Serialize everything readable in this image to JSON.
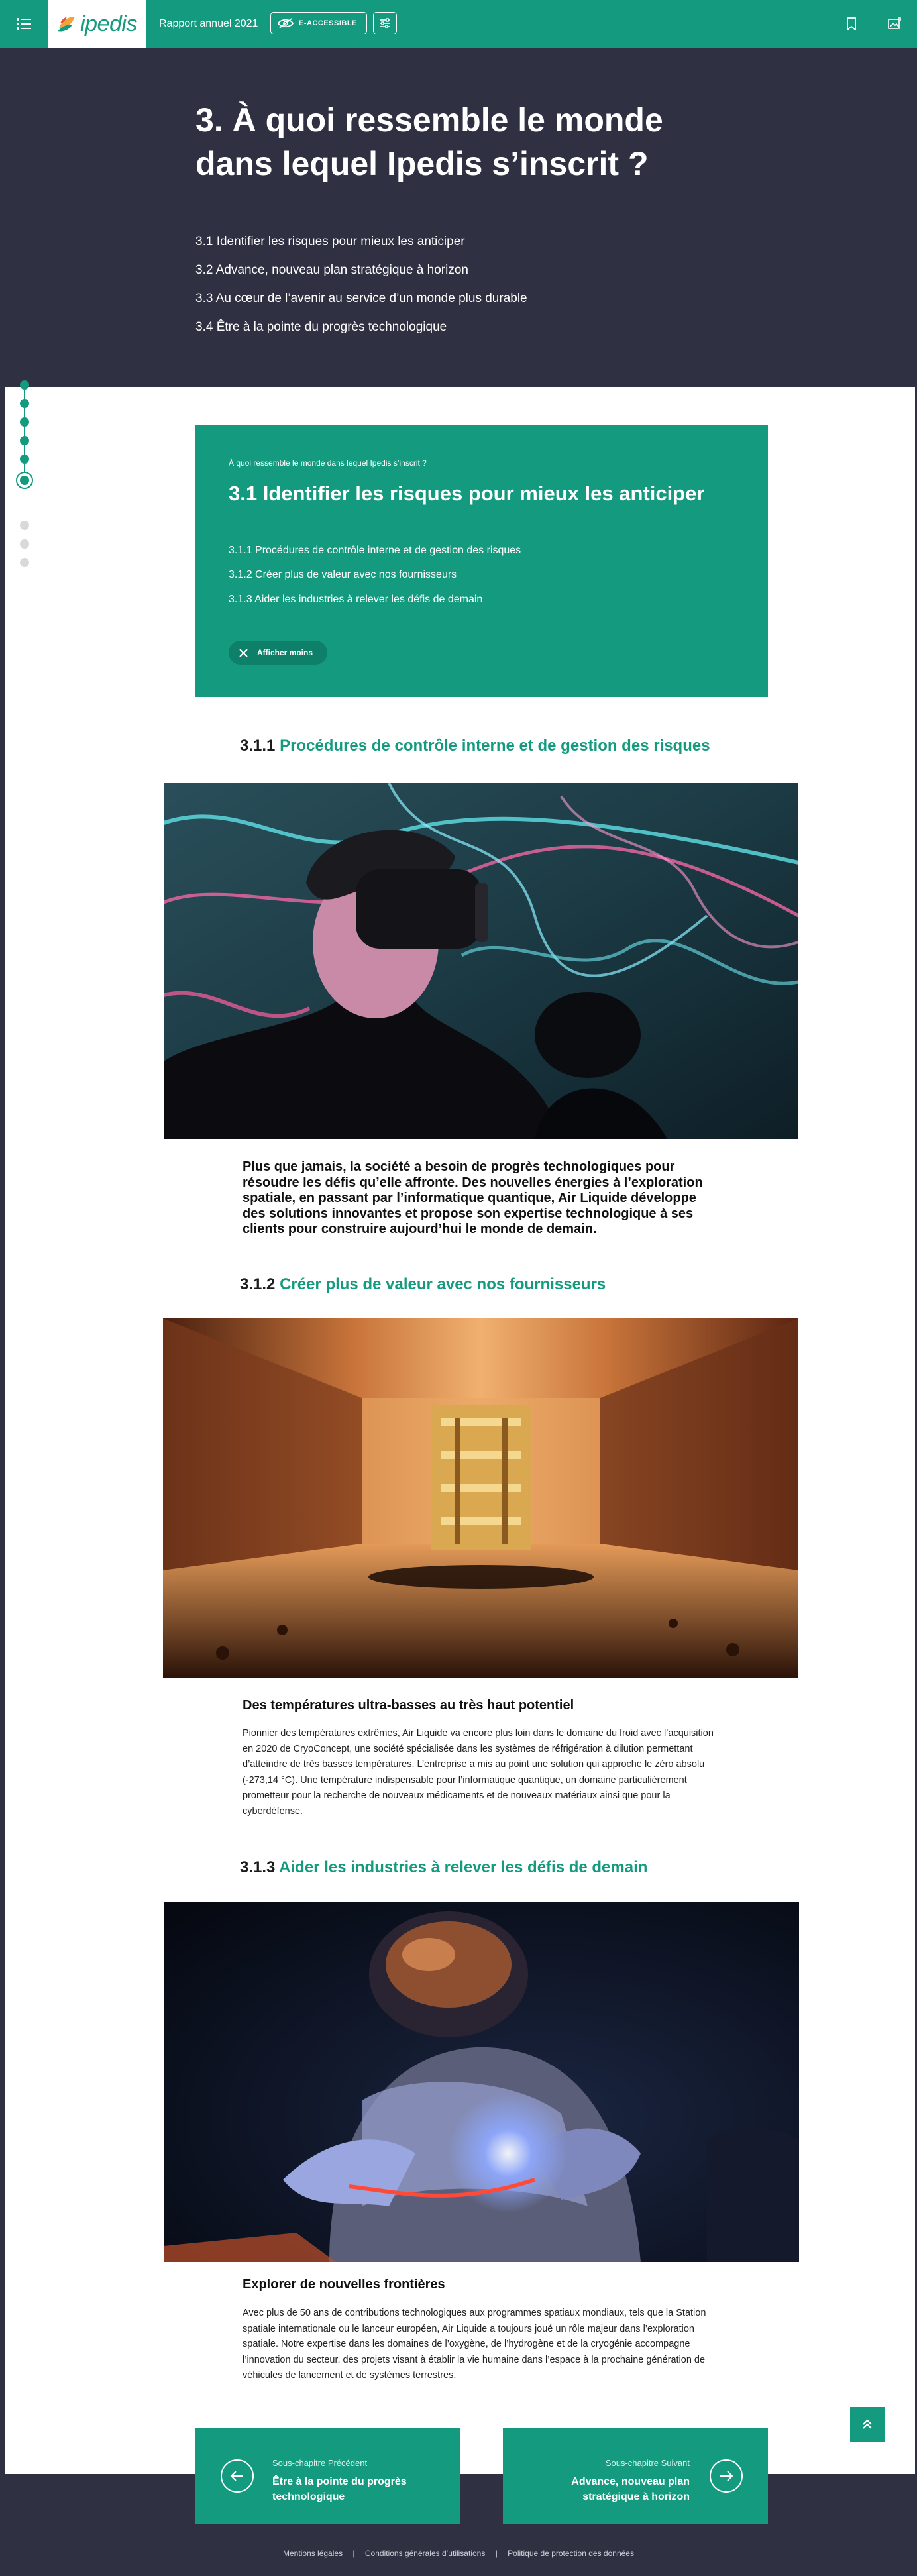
{
  "topbar": {
    "logo_text": "ipedis",
    "report_label": "Rapport annuel 2021",
    "accessible_label": "E-ACCESSIBLE",
    "icons": [
      "menu-icon",
      "eye-off-icon",
      "sliders-icon",
      "bookmark-icon",
      "image-icon"
    ]
  },
  "hero": {
    "title": "3. À quoi ressemble le monde dans lequel Ipedis s’inscrit ?",
    "toc": [
      "3.1 Identifier les risques pour mieux les anticiper",
      "3.2 Advance, nouveau plan stratégique à horizon",
      "3.3 Au cœur de l’avenir au service d’un monde plus durable",
      "3.4 Être à la pointe du progrès technologique"
    ]
  },
  "section": {
    "breadcrumb": "À quoi ressemble le monde dans lequel Ipedis s’inscrit ?",
    "title": "3.1 Identifier les risques pour mieux les anticiper",
    "subs": [
      "3.1.1 Procédures de contrôle interne et de gestion des risques",
      "3.1.2 Créer plus de valeur avec nos fournisseurs",
      "3.1.3 Aider les industries à relever les défis de demain"
    ],
    "toggle_label": "Afficher moins"
  },
  "s1": {
    "num": "3.1.1",
    "title": "Procédures de contrôle interne et de gestion des risques",
    "intro": "Plus que jamais, la société a besoin de progrès technologiques pour résoudre les défis qu’elle affronte. Des nouvelles énergies à l’exploration spatiale, en passant par l’informatique quantique, Air Liquide développe des solutions innovantes et propose son expertise technologique à ses clients pour construire aujourd’hui le monde de demain."
  },
  "s2": {
    "num": "3.1.2",
    "title": "Créer plus de valeur avec nos fournisseurs",
    "subheading": "Des températures ultra-basses au très haut potentiel",
    "body": "Pionnier des températures extrêmes, Air Liquide va encore plus loin dans le domaine du froid avec l’acquisition en 2020 de CryoConcept, une société spécialisée dans les systèmes de réfrigération à dilution permettant d’atteindre de très basses températures. L’entreprise a mis au point une solution qui approche le zéro absolu (-273,14 °C). Une température indispensable pour l’informatique quantique, un domaine particulièrement prometteur pour la recherche de nouveaux médicaments et de nouveaux matériaux ainsi que pour la cyberdéfense."
  },
  "s3": {
    "num": "3.1.3",
    "title": "Aider les industries à relever les défis de demain",
    "subheading": "Explorer de nouvelles frontières",
    "body": "Avec plus de 50 ans de contributions technologiques aux programmes spatiaux mondiaux, tels que la Station spatiale internationale ou le lanceur européen, Air Liquide a toujours joué un rôle majeur dans l’exploration spatiale. Notre expertise dans les domaines de l’oxygène, de l’hydrogène et de la cryogénie accompagne l’innovation du secteur, des projets visant à établir la vie humaine dans l’espace à la prochaine génération de véhicules de lancement et de systèmes terrestres."
  },
  "nav": {
    "prev_small": "Sous-chapitre Précédent",
    "prev_title": "Être à la pointe du progrès technologique",
    "next_small": "Sous-chapitre Suivant",
    "next_title": "Advance, nouveau plan stratégique à horizon"
  },
  "footer": {
    "links": [
      "Mentions légales",
      "Conditions générales d’utilisations",
      "Politique de protection des données"
    ]
  },
  "colors": {
    "brand_green": "#149a7e",
    "dark_navy": "#2f3142"
  }
}
